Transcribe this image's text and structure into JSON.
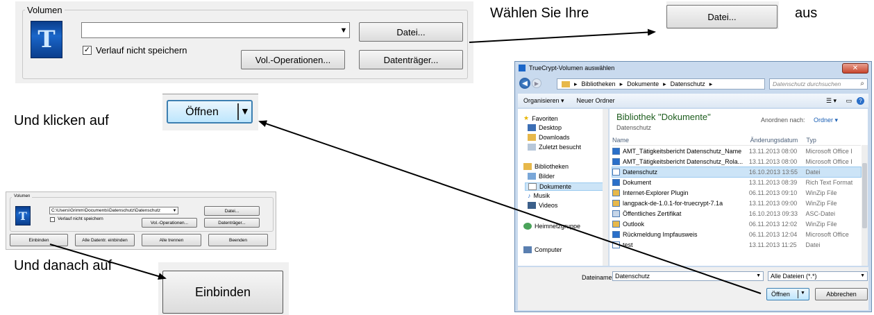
{
  "instructions": {
    "step1_prefix": "Wählen Sie Ihre",
    "step1_suffix": "aus",
    "step2": "Und klicken auf",
    "step3": "Und danach auf"
  },
  "callouts": {
    "datei_button": "Datei...",
    "oeffnen_button": "Öffnen",
    "einbinden_button": "Einbinden"
  },
  "volume_panel_large": {
    "group_label": "Volumen",
    "path_value": "",
    "checkbox_label": "Verlauf nicht speichern",
    "checkbox_checked": true,
    "datei_button": "Datei...",
    "vol_ops_button": "Vol.-Operationen...",
    "datentraeger_button": "Datenträger..."
  },
  "volume_panel_small": {
    "group_label": "Volumen",
    "path_value": "C:\\Users\\Grimm\\Documents\\Datenschutz\\Datenschutz",
    "checkbox_label": "Verlauf nicht speichern",
    "datei_button": "Datei...",
    "vol_ops_button": "Vol.-Operationen...",
    "datentraeger_button": "Datenträger...",
    "bottom_buttons": [
      "Einbinden",
      "Alle Datentr. einbinden",
      "Alle trennen",
      "Beenden"
    ]
  },
  "file_dialog": {
    "title": "TrueCrypt-Volumen auswählen",
    "breadcrumb": [
      "Bibliotheken",
      "Dokumente",
      "Datenschutz"
    ],
    "search_placeholder": "Datenschutz durchsuchen",
    "toolbar": {
      "organize": "Organisieren ▾",
      "new_folder": "Neuer Ordner"
    },
    "nav": {
      "favorites": "Favoriten",
      "desktop": "Desktop",
      "downloads": "Downloads",
      "recent": "Zuletzt besucht",
      "libraries": "Bibliotheken",
      "pictures": "Bilder",
      "documents": "Dokumente",
      "music": "Musik",
      "videos": "Videos",
      "homegroup": "Heimnetzgruppe",
      "computer": "Computer"
    },
    "library_title": "Bibliothek \"Dokumente\"",
    "library_sub": "Datenschutz",
    "arrange_label": "Anordnen nach:",
    "arrange_value": "Ordner ▾",
    "columns": [
      "Name",
      "Änderungsdatum",
      "Typ"
    ],
    "files": [
      {
        "name": "AMT_Tätigkeitsbericht Datenschutz_Name",
        "date": "13.11.2013 08:00",
        "type": "Microsoft Office I"
      },
      {
        "name": "AMT_Tätigkeitsbericht Datenschutz_Rola...",
        "date": "13.11.2013 08:00",
        "type": "Microsoft Office I"
      },
      {
        "name": "Datenschutz",
        "date": "16.10.2013 13:55",
        "type": "Datei"
      },
      {
        "name": "Dokument",
        "date": "13.11.2013 08:39",
        "type": "Rich Text Format"
      },
      {
        "name": "Internet-Explorer Plugin",
        "date": "06.11.2013 09:10",
        "type": "WinZip File"
      },
      {
        "name": "langpack-de-1.0.1-for-truecrypt-7.1a",
        "date": "13.11.2013 09:00",
        "type": "WinZip File"
      },
      {
        "name": "Öffentliches Zertifikat",
        "date": "16.10.2013 09:33",
        "type": "ASC-Datei"
      },
      {
        "name": "Outlook",
        "date": "06.11.2013 12:02",
        "type": "WinZip File"
      },
      {
        "name": "Rückmeldung Impfausweis",
        "date": "06.11.2013 12:04",
        "type": "Microsoft Office"
      },
      {
        "name": "test",
        "date": "13.11.2013 11:25",
        "type": "Datei"
      }
    ],
    "filename_label": "Dateiname:",
    "filename_value": "Datenschutz",
    "filter_value": "Alle Dateien (*.*)",
    "open_button": "Öffnen",
    "cancel_button": "Abbrechen"
  }
}
